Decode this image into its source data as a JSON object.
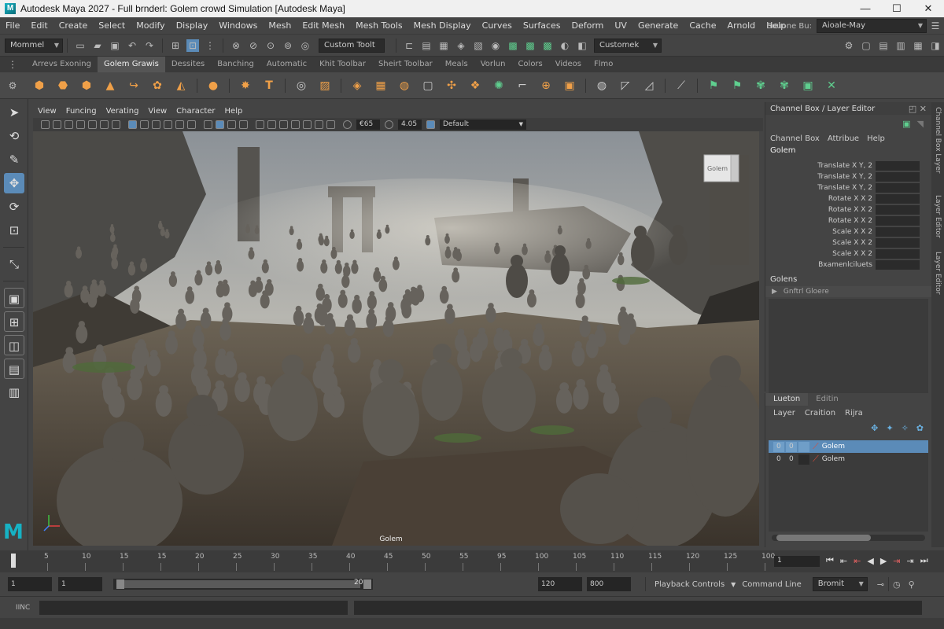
{
  "window": {
    "title": "Autodesk Maya 2027 - Full brnderl: Golem crowd Simulation   [Autodesk Maya]",
    "min": "—",
    "max": "☐",
    "close": "✕"
  },
  "menubar": {
    "items": [
      "File",
      "Edit",
      "Create",
      "Select",
      "Modify",
      "Display",
      "Windows",
      "Mesh",
      "Edit Mesh",
      "Mesh Tools",
      "Mesh Display",
      "Curves",
      "Surfaces",
      "Deform",
      "UV",
      "Generate",
      "Cache",
      "Arnold",
      "Help"
    ],
    "source_label": "Souone Bu:",
    "source_value": "Aioale-May"
  },
  "statusline": {
    "mode": "Mommel",
    "custom_tool": "Custom Toolt",
    "custom_menu": "Customek"
  },
  "shelf": {
    "tabs": [
      "Arrevs Exoning",
      "Golem Grawis",
      "Dessites",
      "Banching",
      "Automatic",
      "Khit Toolbar",
      "Sheirt Toolbar",
      "Meals",
      "Vorlun",
      "Colors",
      "Videos",
      "Flmo"
    ],
    "active_tab": 1
  },
  "viewport": {
    "menu": [
      "View",
      "Funcing",
      "Verating",
      "View",
      "Character",
      "Help"
    ],
    "field1": "€65",
    "field2": "4.05",
    "camera": "Default",
    "label": "Golem",
    "viewcube_label": "Golem"
  },
  "channelbox": {
    "title": "Channel Box / Layer Editor",
    "menu": [
      "Channel Box",
      "Attribue",
      "Help"
    ],
    "object": "Golem",
    "attrs": [
      "Translate X Y, 2",
      "Translate X Y, 2",
      "Translate X Y, 2",
      "Rotate X X 2",
      "Rotate X X 2",
      "Rotate X X 2",
      "Scale X X 2",
      "Scale X X 2",
      "Scale X X 2",
      "Bxamenlciluets"
    ],
    "shapes_header": "Golens",
    "shapes_item": "Gnftrl Gloere"
  },
  "layers": {
    "tabs": [
      "Lueton",
      "Editin"
    ],
    "menu": [
      "Layer",
      "Craition",
      "Rijra"
    ],
    "rows": [
      {
        "v": "0",
        "p": "0",
        "name": "Golem",
        "color": "#d94c3a"
      },
      {
        "v": "0",
        "p": "0",
        "name": "Golem",
        "color": "#d94c3a"
      }
    ]
  },
  "sidetabs": [
    "Channel Box Layer",
    "Layer Editor",
    "Layer Editor"
  ],
  "timeline": {
    "ticks": [
      "5",
      "10",
      "15",
      "15",
      "20",
      "25",
      "30",
      "35",
      "40",
      "45",
      "50",
      "55",
      "95",
      "100",
      "105",
      "110",
      "115",
      "120",
      "125",
      "100"
    ],
    "current": "1"
  },
  "range": {
    "start": "1",
    "start2": "1",
    "slider_end": "20",
    "end": "120",
    "end2": "800",
    "playback": "Playback Controls",
    "cmdline_label": "Command Line",
    "render": "Bromit"
  },
  "cmd": {
    "lang": "IINC"
  },
  "accent": "#5b8bb8"
}
